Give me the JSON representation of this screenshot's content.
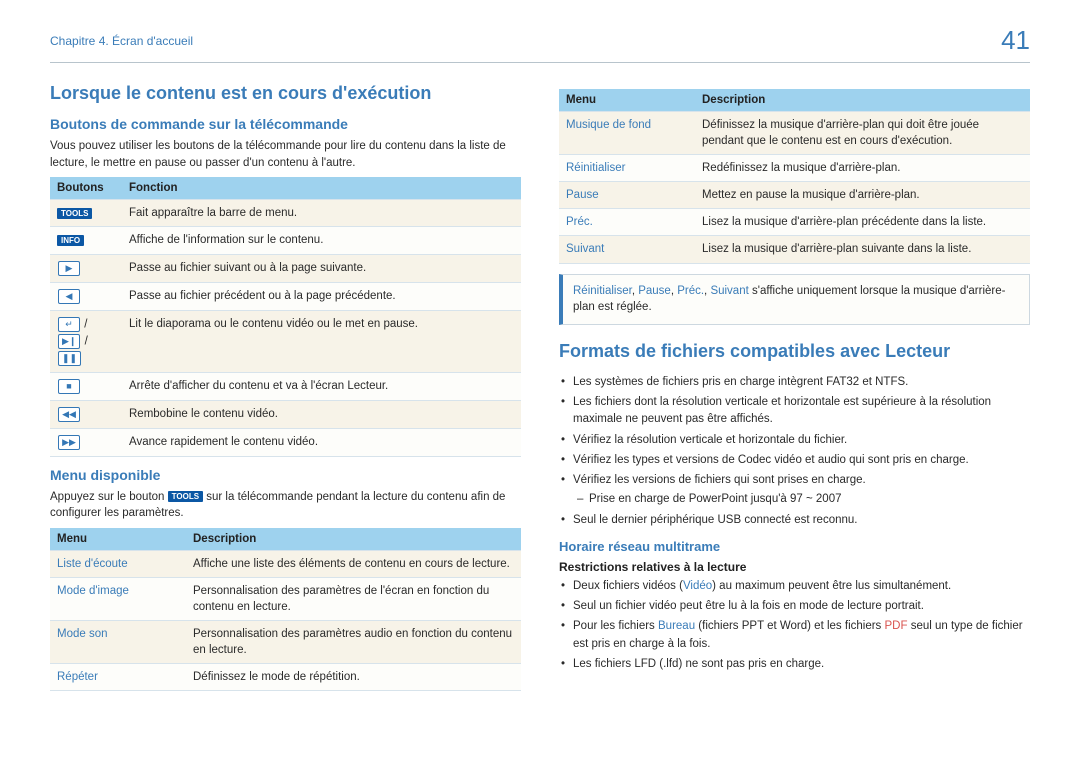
{
  "header": {
    "chapter": "Chapitre 4. Écran d'accueil",
    "page_number": "41"
  },
  "left": {
    "h1": "Lorsque le contenu est en cours d'exécution",
    "h2_buttons": "Boutons de commande sur la télécommande",
    "p_buttons": "Vous pouvez utiliser les boutons de la télécommande pour lire du contenu dans la liste de lecture, le mettre en pause ou passer d'un contenu à l'autre.",
    "tbl_buttons": {
      "head": [
        "Boutons",
        "Fonction"
      ],
      "rows": [
        {
          "btn_label": "TOOLS",
          "fn": "Fait apparaître la barre de menu."
        },
        {
          "btn_label": "INFO",
          "fn": "Affiche de l'information sur le contenu."
        },
        {
          "btn_glyph": "▶",
          "fn": "Passe au fichier suivant ou à la page suivante."
        },
        {
          "btn_glyph": "◀",
          "fn": "Passe au fichier précédent ou à la page précédente."
        },
        {
          "btn_combo": [
            "↵",
            "▶❙",
            "❚❚"
          ],
          "fn": "Lit le diaporama ou le contenu vidéo ou le met en pause."
        },
        {
          "btn_glyph": "■",
          "fn": "Arrête d'afficher du contenu et va à l'écran Lecteur."
        },
        {
          "btn_glyph": "◀◀",
          "fn": "Rembobine le contenu vidéo."
        },
        {
          "btn_glyph": "▶▶",
          "fn": "Avance rapidement le contenu vidéo."
        }
      ]
    },
    "h2_menu": "Menu disponible",
    "p_menu_pre": "Appuyez sur le bouton ",
    "p_menu_badge": "TOOLS",
    "p_menu_post": " sur la télécommande pendant la lecture du contenu afin de configurer les paramètres.",
    "tbl_menu1": {
      "head": [
        "Menu",
        "Description"
      ],
      "rows": [
        {
          "name": "Liste d'écoute",
          "desc": "Affiche une liste des éléments de contenu en cours de lecture."
        },
        {
          "name": "Mode d'image",
          "desc": "Personnalisation des paramètres de l'écran en fonction du contenu en lecture."
        },
        {
          "name": "Mode son",
          "desc": "Personnalisation des paramètres audio en fonction du contenu en lecture."
        },
        {
          "name": "Répéter",
          "desc": "Définissez le mode de répétition."
        }
      ]
    }
  },
  "right": {
    "tbl_menu2": {
      "head": [
        "Menu",
        "Description"
      ],
      "rows": [
        {
          "name": "Musique de fond",
          "desc": "Définissez la musique d'arrière-plan qui doit être jouée pendant que le contenu est en cours d'exécution."
        },
        {
          "name": "Réinitialiser",
          "desc": "Redéfinissez la musique d'arrière-plan."
        },
        {
          "name": "Pause",
          "desc": "Mettez en pause la musique d'arrière-plan."
        },
        {
          "name": "Préc.",
          "desc": "Lisez la musique d'arrière-plan précédente dans la liste."
        },
        {
          "name": "Suivant",
          "desc": "Lisez la musique d'arrière-plan suivante dans la liste."
        }
      ]
    },
    "note": {
      "items": [
        "Réinitialiser",
        "Pause",
        "Préc.",
        "Suivant"
      ],
      "sep": ", ",
      "tail": " s'affiche uniquement lorsque la musique d'arrière-plan est réglée."
    },
    "h1_formats": "Formats de fichiers compatibles avec Lecteur",
    "formats_list": [
      {
        "text": "Les systèmes de fichiers pris en charge intègrent FAT32 et NTFS."
      },
      {
        "text": "Les fichiers dont la résolution verticale et horizontale est supérieure à la résolution maximale ne peuvent pas être affichés."
      },
      {
        "text": "Vérifiez la résolution verticale et horizontale du fichier."
      },
      {
        "text": "Vérifiez les types et versions de Codec vidéo et audio qui sont pris en charge."
      },
      {
        "text": "Vérifiez les versions de fichiers qui sont prises en charge.",
        "dash": "Prise en charge de PowerPoint jusqu'à 97 ~ 2007"
      },
      {
        "text": "Seul le dernier périphérique USB connecté est reconnu."
      }
    ],
    "h3_horaire": "Horaire réseau multitrame",
    "h4_restrict": "Restrictions relatives à la lecture",
    "restrict_list": [
      {
        "pre": "Deux fichiers vidéos (",
        "hl": "Vidéo",
        "post": ") au maximum peuvent être lus simultanément."
      },
      {
        "text": "Seul un fichier vidéo peut être lu à la fois en mode de lecture portrait."
      },
      {
        "pre": "Pour les fichiers ",
        "hl": "Bureau",
        "mid": " (fichiers PPT et Word) et les fichiers ",
        "hl2": "PDF",
        "post": " seul un type de fichier est pris en charge à la fois."
      },
      {
        "text": "Les fichiers LFD (.lfd) ne sont pas pris en charge."
      }
    ]
  }
}
